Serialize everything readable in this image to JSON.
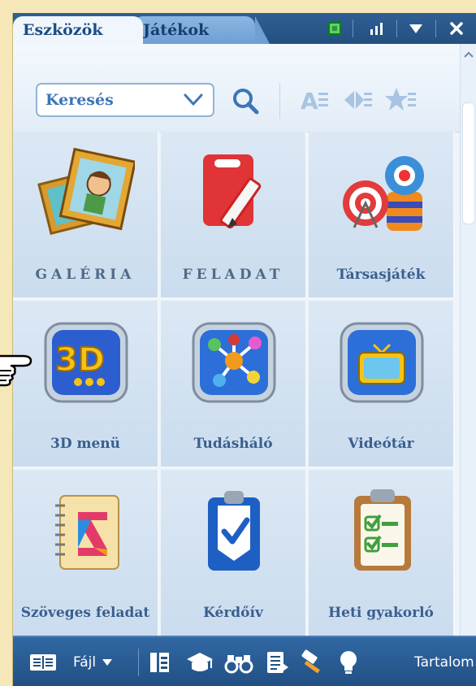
{
  "tabs": [
    {
      "label": "Eszközök",
      "active": true
    },
    {
      "label": "Játékok",
      "active": false
    }
  ],
  "window_controls": [
    "restore-icon",
    "bars-icon",
    "dropdown-icon",
    "close-icon"
  ],
  "search": {
    "placeholder": "Keresés"
  },
  "toolbar_icons": [
    "search-icon",
    "text-size-icon",
    "layout-icon",
    "favorites-icon"
  ],
  "grid_items": [
    {
      "label": "GALÉRIA",
      "icon": "gallery-icon"
    },
    {
      "label": "FELADAT",
      "icon": "task-icon"
    },
    {
      "label": "Társasjáték",
      "icon": "board-game-icon"
    },
    {
      "label": "3D menü",
      "icon": "3d-menu-icon"
    },
    {
      "label": "Tudásháló",
      "icon": "knowledge-network-icon"
    },
    {
      "label": "Videótár",
      "icon": "video-library-icon"
    },
    {
      "label": "Szöveges feladat",
      "icon": "text-task-icon"
    },
    {
      "label": "Kérdőív",
      "icon": "questionnaire-icon"
    },
    {
      "label": "Heti gyakorló",
      "icon": "weekly-practice-icon"
    }
  ],
  "bottom_bar": {
    "file_label": "Fájl",
    "content_label": "Tartalom"
  },
  "colors": {
    "header": "#24507f",
    "accent": "#3b76b8",
    "background": "#f5e7b8"
  }
}
